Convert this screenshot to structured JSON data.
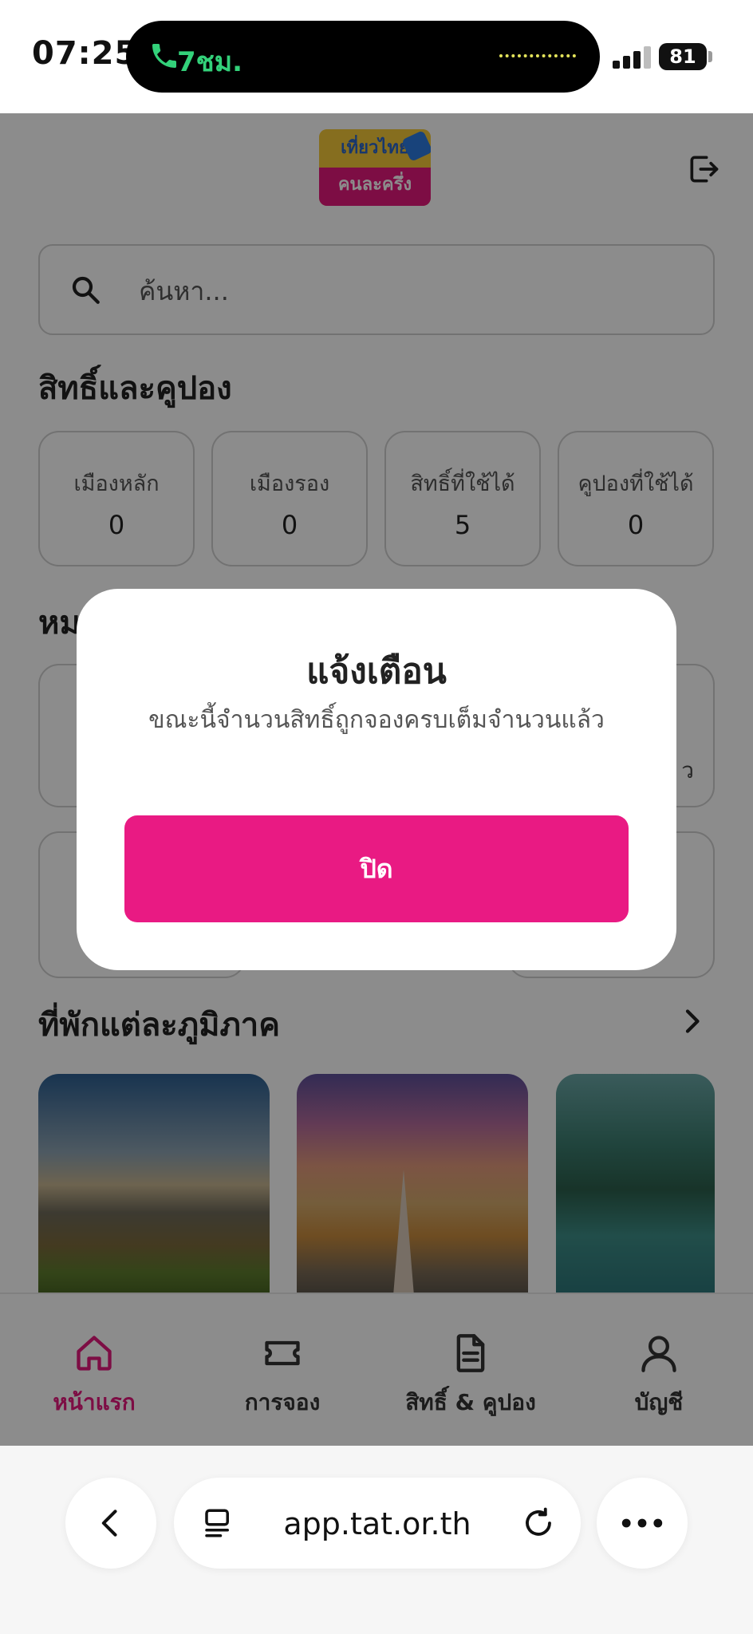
{
  "status_bar": {
    "time": "07:25",
    "call_duration": "7ชม.",
    "battery": "81"
  },
  "header": {
    "logo_line1": "เที่ยวไทย",
    "logo_line2": "คนละครึ่ง"
  },
  "search": {
    "placeholder": "ค้นหา..."
  },
  "rights_section": {
    "title": "สิทธิ์และคูปอง",
    "stats": [
      {
        "label": "เมืองหลัก",
        "value": "0"
      },
      {
        "label": "เมืองรอง",
        "value": "0"
      },
      {
        "label": "สิทธิ์ที่ใช้ได้",
        "value": "5"
      },
      {
        "label": "คูปองที่ใช้ได้",
        "value": "0"
      }
    ]
  },
  "category_section": {
    "title_fragment": "หม",
    "card_fragment": "ว"
  },
  "region_section": {
    "title": "ที่พักแต่ละภูมิภาค"
  },
  "tabs": [
    {
      "label": "หน้าแรก",
      "active": true
    },
    {
      "label": "การจอง",
      "active": false
    },
    {
      "label": "สิทธิ์ & คูปอง",
      "active": false
    },
    {
      "label": "บัญชี",
      "active": false
    }
  ],
  "modal": {
    "title": "แจ้งเตือน",
    "message": "ขณะนี้จำนวนสิทธิ์ถูกจองครบเต็มจำนวนแล้ว",
    "close_label": "ปิด"
  },
  "browser": {
    "url": "app.tat.or.th"
  },
  "colors": {
    "brand_pink": "#e91a83",
    "call_green": "#33d17a"
  }
}
